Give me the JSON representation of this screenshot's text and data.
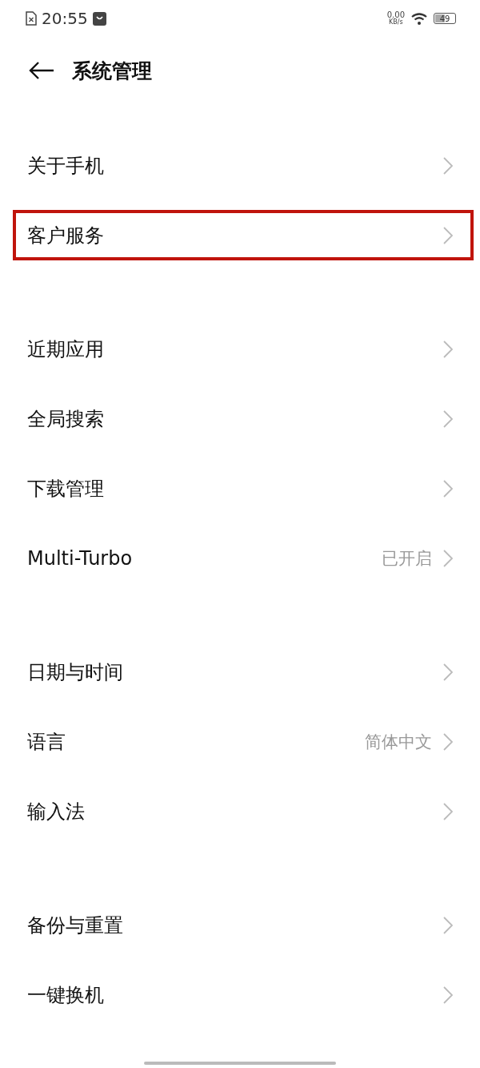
{
  "status_bar": {
    "time": "20:55",
    "net_speed": "0.00",
    "net_unit": "KB/s",
    "battery": "49"
  },
  "header": {
    "title": "系统管理"
  },
  "groups": [
    {
      "items": [
        {
          "label": "关于手机",
          "highlighted": false
        },
        {
          "label": "客户服务",
          "highlighted": true
        }
      ]
    },
    {
      "items": [
        {
          "label": "近期应用",
          "highlighted": false
        },
        {
          "label": "全局搜索",
          "highlighted": false
        },
        {
          "label": "下载管理",
          "highlighted": false
        },
        {
          "label": "Multi-Turbo",
          "value": "已开启",
          "highlighted": false
        }
      ]
    },
    {
      "items": [
        {
          "label": "日期与时间",
          "highlighted": false
        },
        {
          "label": "语言",
          "value": "简体中文",
          "highlighted": false
        },
        {
          "label": "输入法",
          "highlighted": false
        }
      ]
    },
    {
      "items": [
        {
          "label": "备份与重置",
          "highlighted": false
        },
        {
          "label": "一键换机",
          "highlighted": false
        }
      ]
    }
  ]
}
